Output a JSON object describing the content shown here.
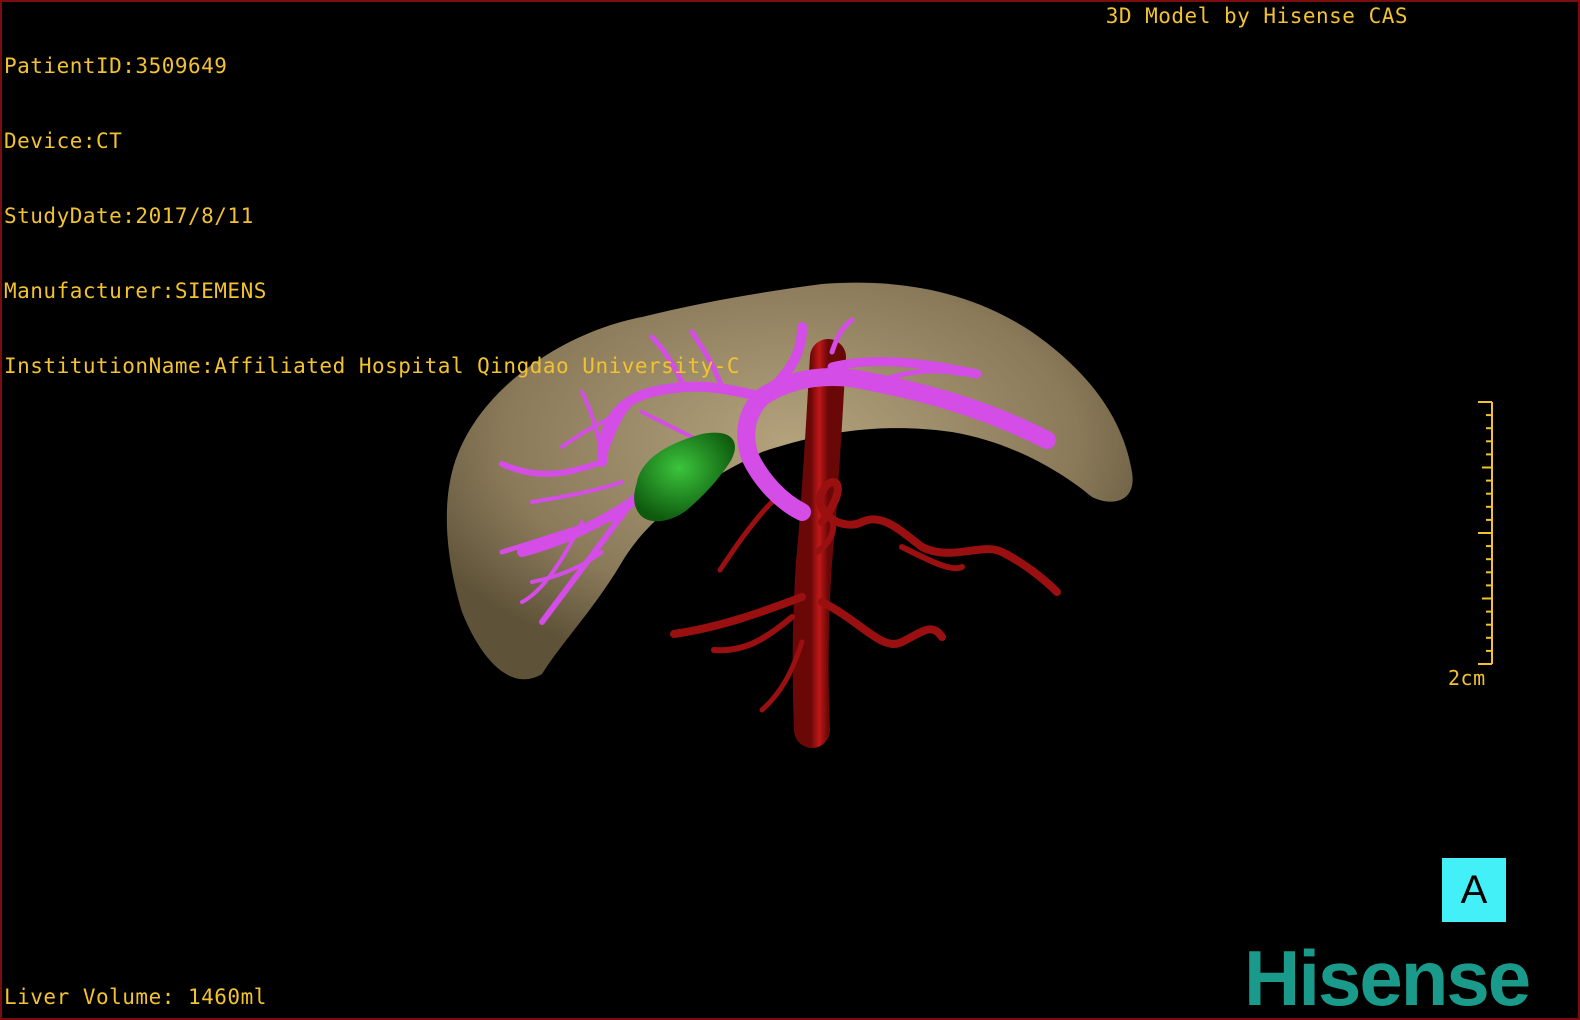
{
  "patient": {
    "id_line": "PatientID:3509649",
    "device_line": "Device:CT",
    "study_date_line": "StudyDate:2017/8/11",
    "manufacturer_line": "Manufacturer:SIEMENS",
    "institution_line": "InstitutionName:Affiliated Hospital Qingdao University-C"
  },
  "header": {
    "brand_text": "3D Model by Hisense CAS"
  },
  "footer": {
    "volume_text": "Liver Volume: 1460ml"
  },
  "scale": {
    "label": "2cm"
  },
  "orientation": {
    "label": "A"
  },
  "logo": {
    "text": "Hisense"
  },
  "colors": {
    "overlay_text": "#f2c230",
    "liver": "#8a7a5a",
    "portal_vein": "#d34de6",
    "gallbladder": "#1e8a1e",
    "aorta": "#9a1010",
    "orientation_box": "#43f0f7",
    "logo": "#1a9a8a"
  }
}
